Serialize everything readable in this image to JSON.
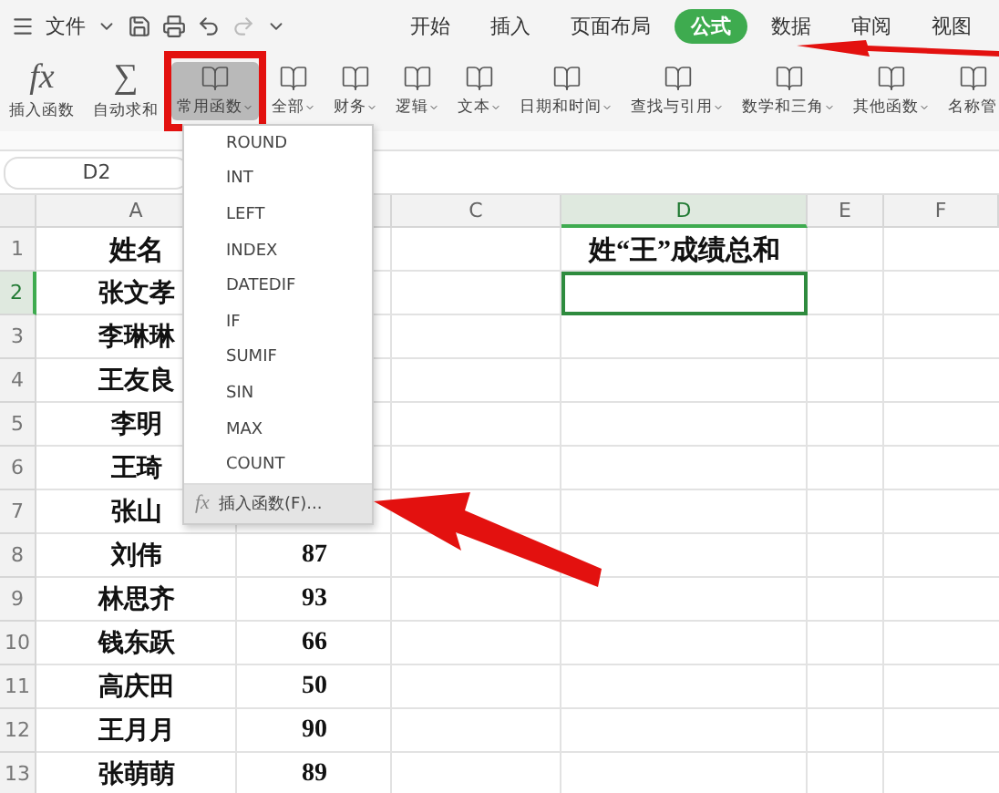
{
  "title_bar": {
    "file_menu": "文件",
    "tabs": [
      {
        "label": "开始",
        "selected": false
      },
      {
        "label": "插入",
        "selected": false
      },
      {
        "label": "页面布局",
        "selected": false
      },
      {
        "label": "公式",
        "selected": true
      },
      {
        "label": "数据",
        "selected": false
      },
      {
        "label": "审阅",
        "selected": false
      },
      {
        "label": "视图",
        "selected": false
      }
    ]
  },
  "ribbon": {
    "buttons": [
      {
        "kind": "glyph",
        "glyph": "fx",
        "label": "插入函数",
        "dropdown": false,
        "selected": false
      },
      {
        "kind": "glyph",
        "glyph": "∑",
        "label": "自动求和",
        "dropdown": false,
        "selected": false
      },
      {
        "kind": "book",
        "label": "常用函数",
        "dropdown": true,
        "selected": true
      },
      {
        "kind": "book",
        "label": "全部",
        "dropdown": true,
        "selected": false
      },
      {
        "kind": "book",
        "label": "财务",
        "dropdown": true,
        "selected": false
      },
      {
        "kind": "book",
        "label": "逻辑",
        "dropdown": true,
        "selected": false
      },
      {
        "kind": "book",
        "label": "文本",
        "dropdown": true,
        "selected": false
      },
      {
        "kind": "book",
        "label": "日期和时间",
        "dropdown": true,
        "selected": false
      },
      {
        "kind": "book",
        "label": "查找与引用",
        "dropdown": true,
        "selected": false
      },
      {
        "kind": "book",
        "label": "数学和三角",
        "dropdown": true,
        "selected": false
      },
      {
        "kind": "book",
        "label": "其他函数",
        "dropdown": true,
        "selected": false
      },
      {
        "kind": "book",
        "label": "名称管",
        "dropdown": false,
        "selected": false
      }
    ]
  },
  "name_box": "D2",
  "sheet": {
    "columns": [
      {
        "label": "A",
        "selected": false
      },
      null,
      {
        "label": "C",
        "selected": false
      },
      {
        "label": "D",
        "selected": true
      },
      {
        "label": "E",
        "selected": false
      },
      {
        "label": "F",
        "selected": false
      }
    ],
    "rows": [
      {
        "number": "1",
        "selected": false,
        "a": "姓名",
        "d": "姓“王”成绩总和"
      },
      {
        "number": "2",
        "selected": true,
        "a": "张文孝"
      },
      {
        "number": "3",
        "selected": false,
        "a": "李琳琳"
      },
      {
        "number": "4",
        "selected": false,
        "a": "王友良"
      },
      {
        "number": "5",
        "selected": false,
        "a": "李明"
      },
      {
        "number": "6",
        "selected": false,
        "a": "王琦"
      },
      {
        "number": "7",
        "selected": false,
        "a": "张山"
      },
      {
        "number": "8",
        "selected": false,
        "a": "刘伟",
        "b": "87"
      },
      {
        "number": "9",
        "selected": false,
        "a": "林思齐",
        "b": "93"
      },
      {
        "number": "10",
        "selected": false,
        "a": "钱东跃",
        "b": "66"
      },
      {
        "number": "11",
        "selected": false,
        "a": "高庆田",
        "b": "50"
      },
      {
        "number": "12",
        "selected": false,
        "a": "王月月",
        "b": "90"
      },
      {
        "number": "13",
        "selected": false,
        "a": "张萌萌",
        "b": "89"
      }
    ]
  },
  "function_menu": {
    "items": [
      {
        "label": "ROUND",
        "selected": false
      },
      {
        "label": "INT",
        "selected": false
      },
      {
        "label": "LEFT",
        "selected": false
      },
      {
        "label": "INDEX",
        "selected": false
      },
      {
        "label": "DATEDIF",
        "selected": false
      },
      {
        "label": "IF",
        "selected": false
      },
      {
        "label": "SUMIF",
        "selected": false
      },
      {
        "label": "SIN",
        "selected": false
      },
      {
        "label": "MAX",
        "selected": false
      },
      {
        "label": "COUNT",
        "selected": false
      }
    ],
    "footer": {
      "glyph": "fx",
      "label": "插入函数(F)...",
      "selected": true
    }
  }
}
